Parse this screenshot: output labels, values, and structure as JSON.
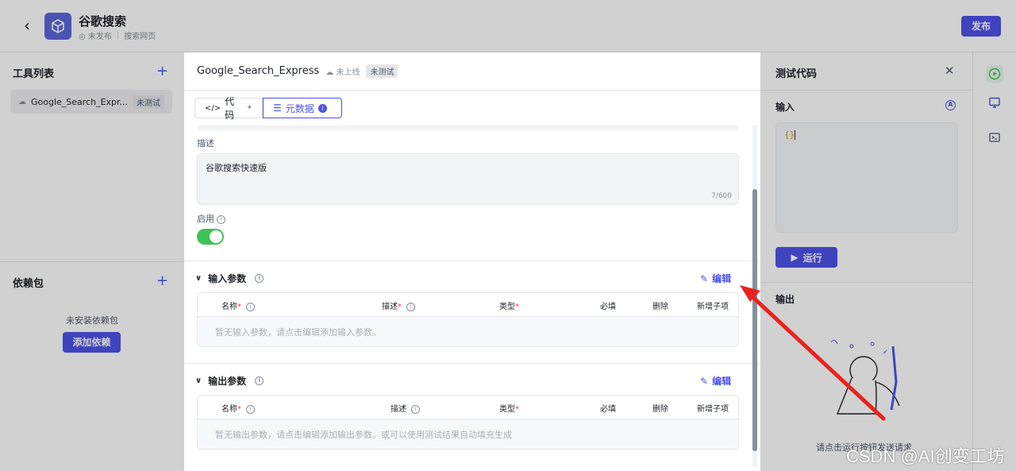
{
  "header": {
    "title": "谷歌搜索",
    "status": "未发布",
    "subtitle": "搜索网页",
    "publish_label": "发布"
  },
  "left_panel": {
    "tools_title": "工具列表",
    "tool_item": {
      "name": "Google_Search_Expr...",
      "badge": "未测试"
    },
    "deps_title": "依赖包",
    "no_deps_text": "未安装依赖包",
    "add_deps_label": "添加依赖"
  },
  "center_panel": {
    "tool_name": "Google_Search_Express",
    "online_status": "未上线",
    "test_badge": "未测试",
    "tabs": [
      {
        "label": "代码"
      },
      {
        "label": "元数据"
      }
    ],
    "description_label": "描述",
    "description_value": "谷歌搜索快速版",
    "description_count": "7/600",
    "enable_label": "启用",
    "enabled": true,
    "input_params": {
      "title": "输入参数",
      "edit_label": "编辑",
      "columns": [
        "名称",
        "描述",
        "类型",
        "必填",
        "删除",
        "新增子项"
      ],
      "empty_text": "暂无输入参数，请点击编辑添加输入参数。"
    },
    "output_params": {
      "title": "输出参数",
      "edit_label": "编辑",
      "columns": [
        "名称",
        "描述",
        "类型",
        "必填",
        "删除",
        "新增子项"
      ],
      "empty_text": "暂无输出参数，请点击编辑添加输出参数。或可以使用测试结果自动填充生成"
    }
  },
  "test_panel": {
    "title": "测试代码",
    "input_label": "输入",
    "code_value": "{}",
    "run_label": "运行",
    "output_label": "输出",
    "hint_text": "请点击运行按钮发送请求"
  },
  "watermark": "CSDN @AI创变工坊",
  "colors": {
    "accent": "#4d53e8",
    "toggle_on": "#3ec254",
    "annotation_arrow": "#e8231f"
  }
}
